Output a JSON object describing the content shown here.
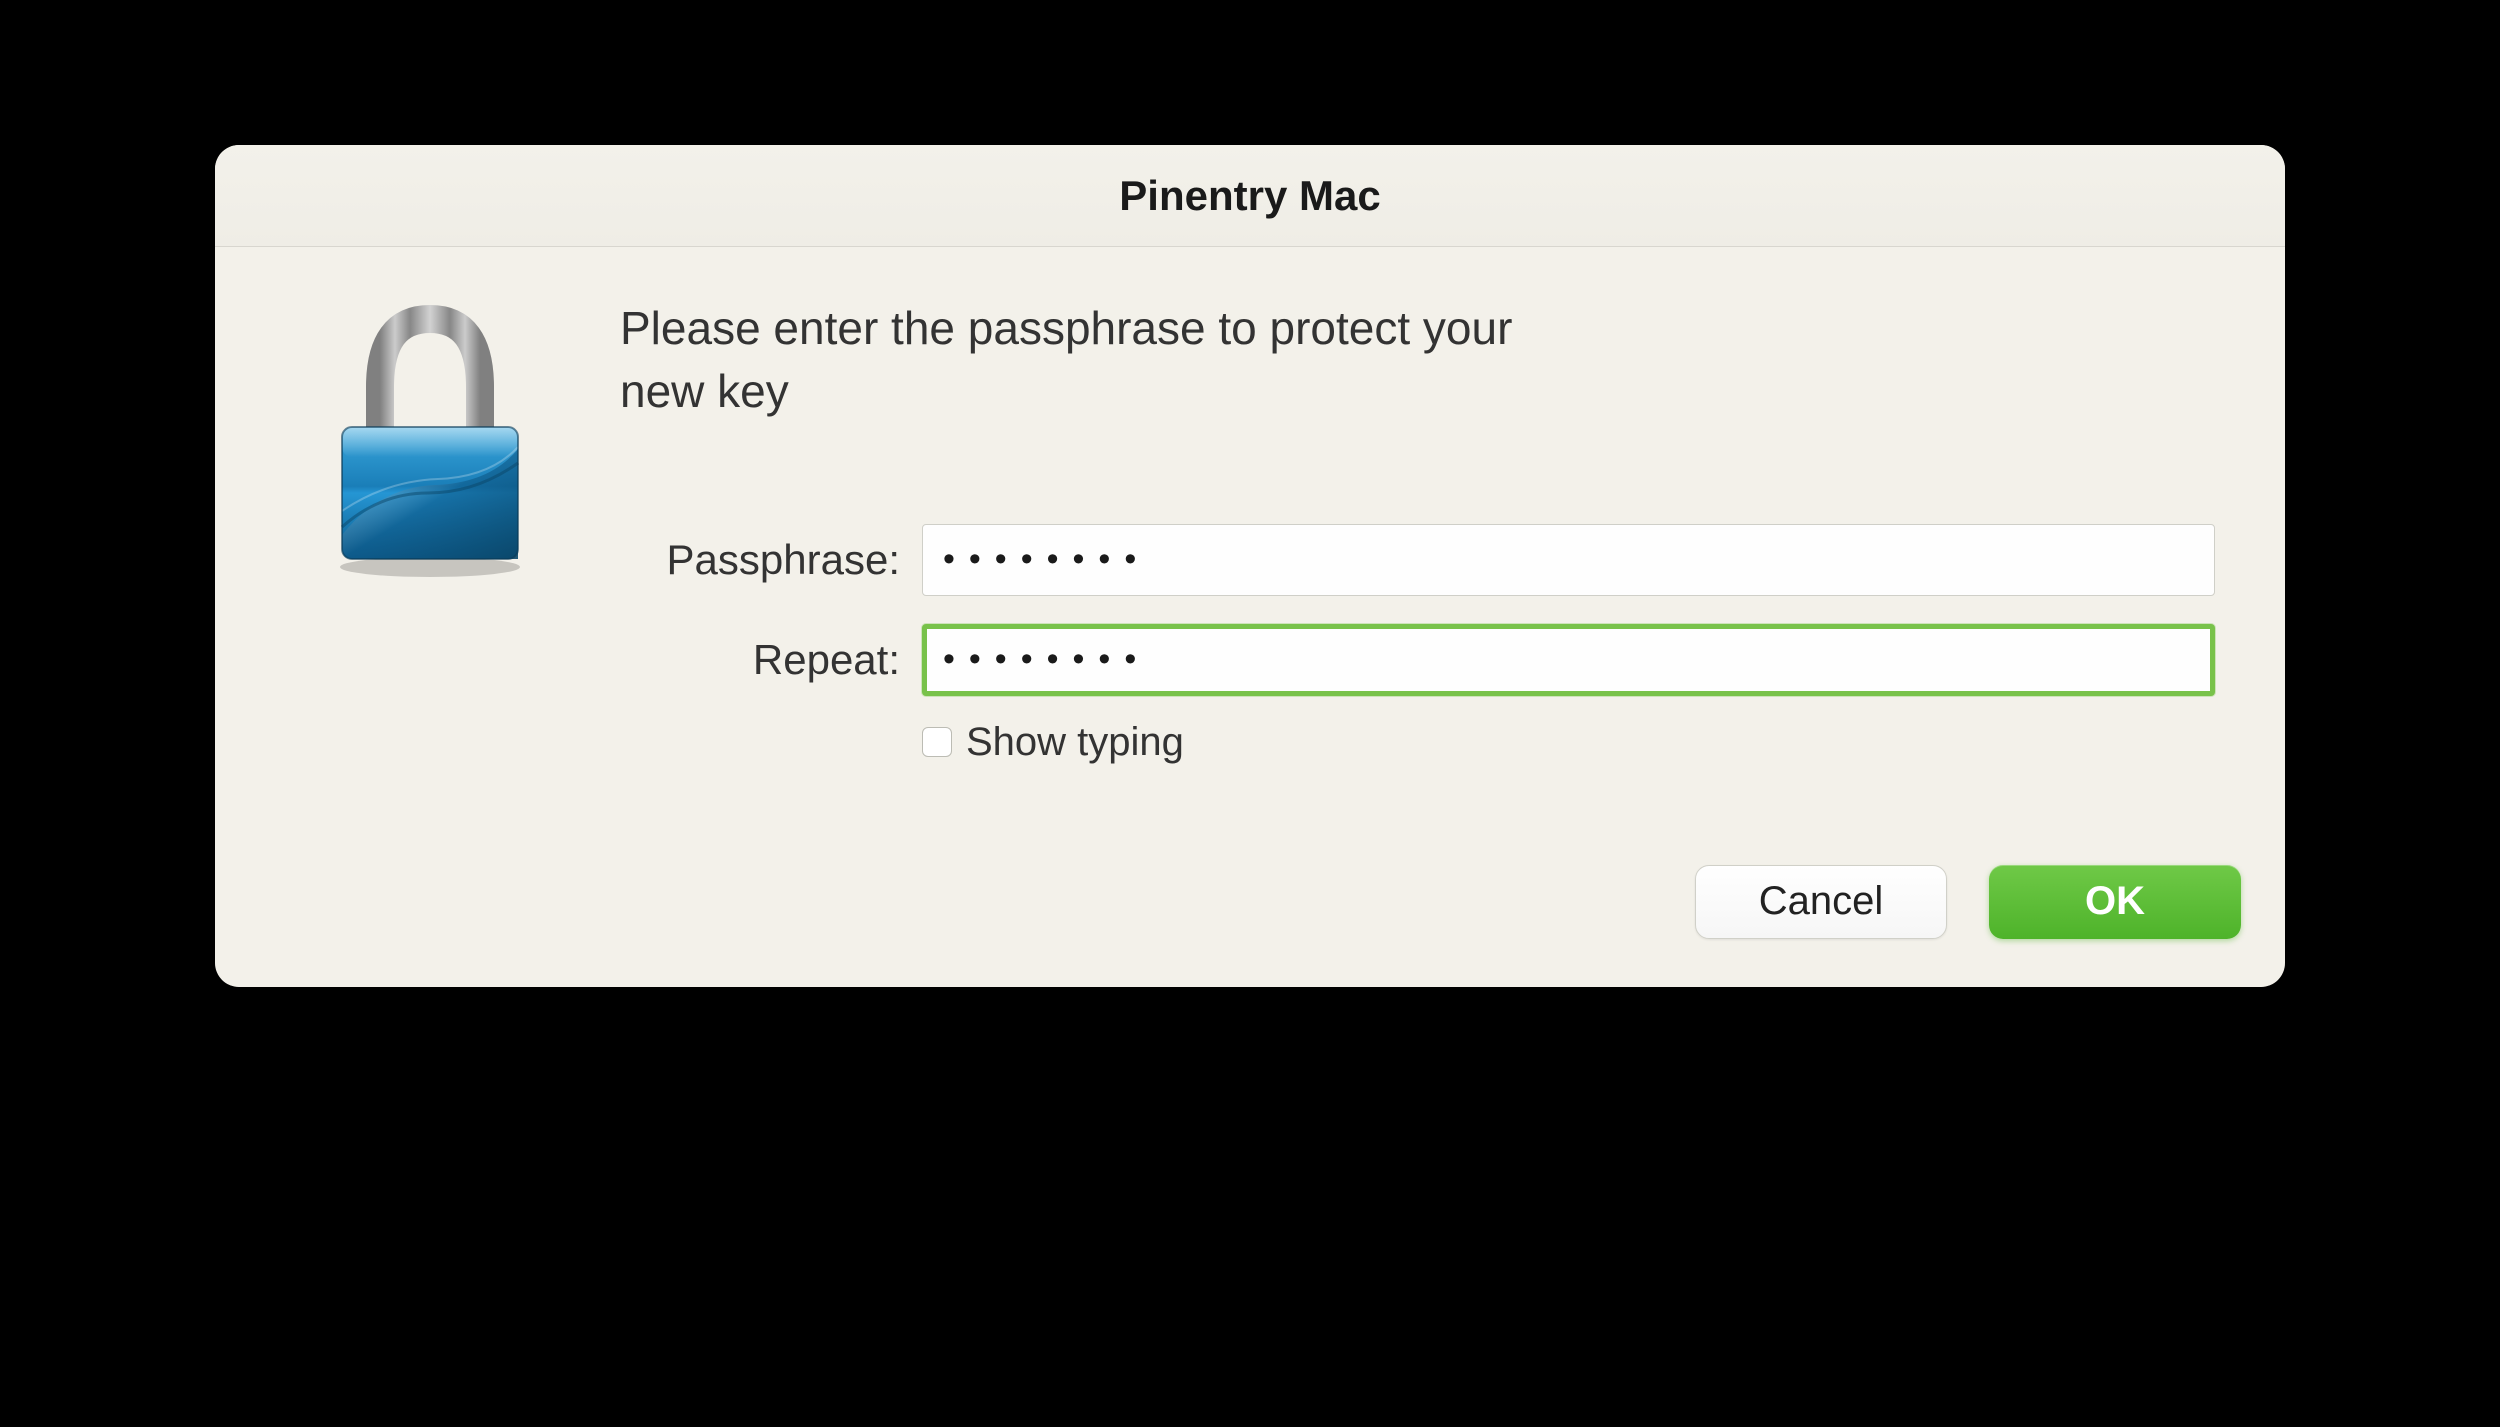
{
  "dialog": {
    "title": "Pinentry Mac",
    "prompt": "Please enter the passphrase to protect your new key",
    "passphrase_label": "Passphrase:",
    "repeat_label": "Repeat:",
    "passphrase_value": "••••••••",
    "repeat_value": "••••••••",
    "show_typing_label": "Show typing",
    "show_typing_checked": false,
    "cancel_label": "Cancel",
    "ok_label": "OK"
  },
  "colors": {
    "accent_green": "#5cbb33",
    "focus_border": "#78c24a",
    "dialog_bg": "#f3f1ea"
  }
}
